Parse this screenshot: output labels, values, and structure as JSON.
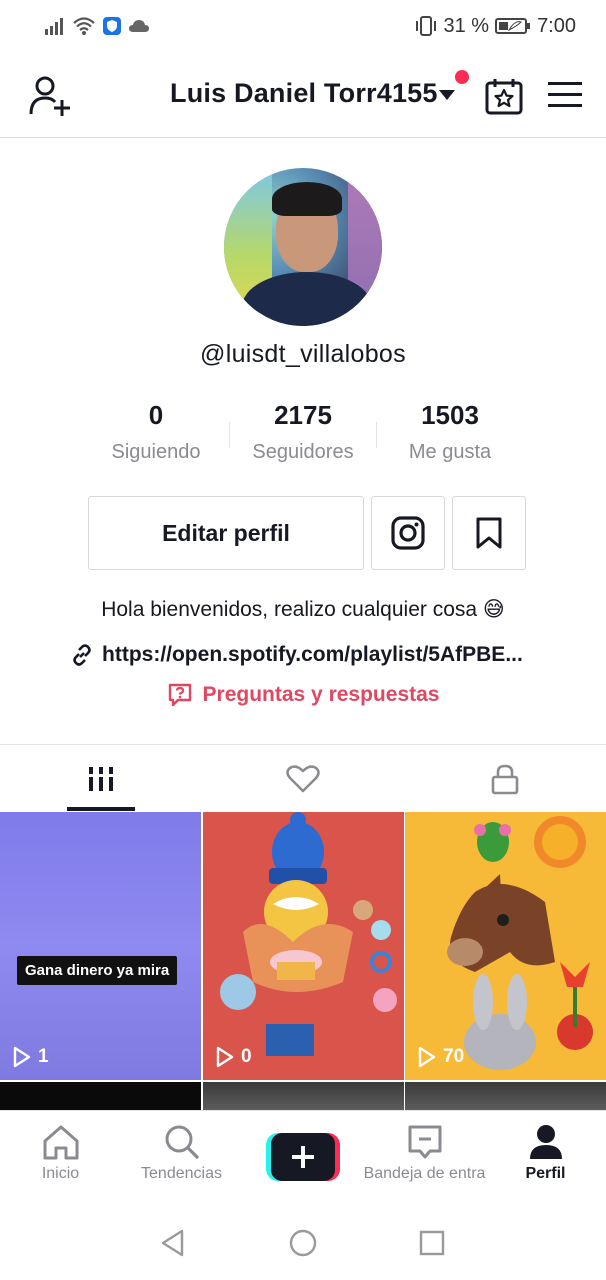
{
  "status_bar": {
    "battery_percent": "31 %",
    "time": "7:00",
    "icons": [
      "signal-icon",
      "wifi-icon",
      "shield-app-icon",
      "cloud-icon",
      "vibrate-icon",
      "battery-icon"
    ]
  },
  "header": {
    "title": "Luis Daniel Torr4155",
    "has_notification_dot": true,
    "icons": [
      "add-user-icon",
      "caret-down-icon",
      "calendar-star-icon",
      "menu-icon"
    ]
  },
  "profile": {
    "handle": "@luisdt_villalobos",
    "stats": [
      {
        "value": "0",
        "label": "Siguiendo"
      },
      {
        "value": "2175",
        "label": "Seguidores"
      },
      {
        "value": "1503",
        "label": "Me gusta"
      }
    ],
    "edit_button": "Editar perfil",
    "bio": "Hola bienvenidos, realizo cualquier cosa 😅",
    "link": "https://open.spotify.com/playlist/5AfPBE...",
    "qa_label": "Preguntas y respuestas"
  },
  "tabs": {
    "items": [
      "videos-grid-icon",
      "heart-icon",
      "lock-icon"
    ],
    "active_index": 0
  },
  "videos": [
    {
      "views": "1",
      "caption": "Gana dinero ya mira"
    },
    {
      "views": "0"
    },
    {
      "views": "70"
    }
  ],
  "bottom_nav": {
    "items": [
      {
        "label": "Inicio",
        "icon": "home-icon"
      },
      {
        "label": "Tendencias",
        "icon": "search-icon"
      },
      {
        "label": "",
        "icon": "create-icon"
      },
      {
        "label": "Bandeja de entra",
        "icon": "inbox-icon"
      },
      {
        "label": "Perfil",
        "icon": "profile-icon"
      }
    ],
    "active": "Perfil"
  },
  "colors": {
    "accent": "#fe2c55",
    "qa_text": "#e04862",
    "text_primary": "#161823",
    "text_secondary": "#8a8b91"
  }
}
